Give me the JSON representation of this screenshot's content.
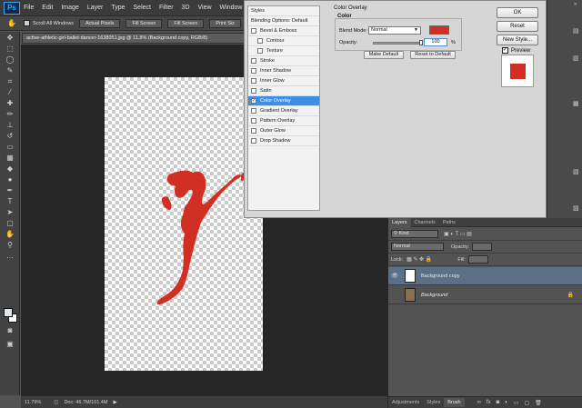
{
  "app": {
    "logo": "Ps"
  },
  "menu": [
    "File",
    "Edit",
    "Image",
    "Layer",
    "Type",
    "Select",
    "Filter",
    "3D",
    "View",
    "Window",
    "He"
  ],
  "options_bar": {
    "scroll_all_windows": "Scroll All Windows",
    "buttons": [
      "Actual Pixels",
      "Fill Screen",
      "Fill Screen",
      "Print Siz"
    ]
  },
  "document": {
    "tab_title": "active-athletic-girl-ballet-dancer-1638051.jpg @ 11.8% (Background copy, RGB/8)",
    "zoom": "11.79%",
    "doc_info": "Doc: 46.7M/101.4M"
  },
  "dialog": {
    "styles_header": "Styles",
    "blending_options": "Blending Options: Default",
    "style_items": [
      {
        "label": "Bevel & Emboss",
        "checked": false,
        "sub": false
      },
      {
        "label": "Contour",
        "checked": false,
        "sub": true
      },
      {
        "label": "Texture",
        "checked": false,
        "sub": true
      },
      {
        "label": "Stroke",
        "checked": false,
        "sub": false
      },
      {
        "label": "Inner Shadow",
        "checked": false,
        "sub": false
      },
      {
        "label": "Inner Glow",
        "checked": false,
        "sub": false
      },
      {
        "label": "Satin",
        "checked": false,
        "sub": false
      },
      {
        "label": "Color Overlay",
        "checked": true,
        "sub": false
      },
      {
        "label": "Gradient Overlay",
        "checked": false,
        "sub": false
      },
      {
        "label": "Pattern Overlay",
        "checked": false,
        "sub": false
      },
      {
        "label": "Outer Glow",
        "checked": false,
        "sub": false
      },
      {
        "label": "Drop Shadow",
        "checked": false,
        "sub": false
      }
    ],
    "panel_title": "Color Overlay",
    "group_title": "Color",
    "blend_mode_label": "Blend Mode:",
    "blend_mode_value": "Normal",
    "overlay_color": "#d12f24",
    "opacity_label": "Opacity:",
    "opacity_value": "100",
    "opacity_unit": "%",
    "make_default": "Make Default",
    "reset_default": "Reset to Default",
    "ok": "OK",
    "reset": "Reset",
    "new_style": "New Style...",
    "preview_label": "Preview",
    "preview_checked": true
  },
  "layers_panel": {
    "tabs": [
      "Layers",
      "Channels",
      "Paths"
    ],
    "filter_label": "Kind",
    "blend_mode": "Normal",
    "opacity_label": "Opacity:",
    "lock_label": "Lock:",
    "fill_label": "Fill:",
    "layers": [
      {
        "name": "Background copy",
        "selected": true,
        "visible": true
      },
      {
        "name": "Background",
        "selected": false,
        "visible": false,
        "locked": true
      }
    ],
    "bottom_tabs": [
      "Adjustments",
      "Styles",
      "Brush"
    ]
  }
}
